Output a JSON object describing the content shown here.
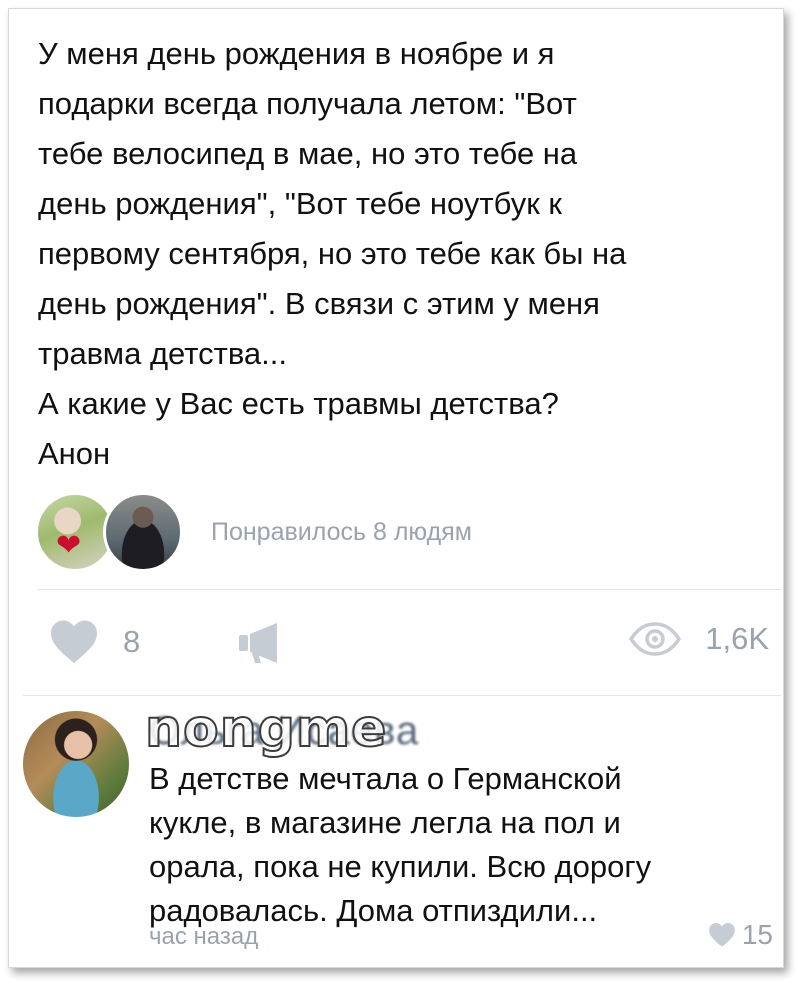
{
  "post": {
    "text": "У меня день рождения в ноябре и я\nподарки всегда получала летом: \"Вот\nтебе велосипед в мае, но это тебе на\nдень рождения\", \"Вот тебе ноутбук к\nпервому сентября, но это тебе как бы на\nдень рождения\". В связи с этим у меня\nтравма детства...\nА какие у Вас есть травмы детства?\nАнон",
    "liked_by_text": "Понравилось 8 людям",
    "like_count": "8",
    "views_count": "1,6K"
  },
  "comment": {
    "author": "Ольга Исаева",
    "text": "В детстве мечтала о Германской\nкукле,  в магазине легла на пол и\nорала, пока не купили. Всю дорогу\nрадовалась. Дома отпиздили...",
    "time": "час назад",
    "like_count": "15"
  },
  "watermark": "nongme",
  "colors": {
    "text": "#111111",
    "muted": "#9aa3ad",
    "icon": "#c6ccd3",
    "divider": "#e2e5e9",
    "sticker_heart": "#c8102e"
  },
  "icons": {
    "like": "heart-icon",
    "share": "megaphone-icon",
    "views": "eye-icon",
    "comment_like": "heart-icon"
  }
}
